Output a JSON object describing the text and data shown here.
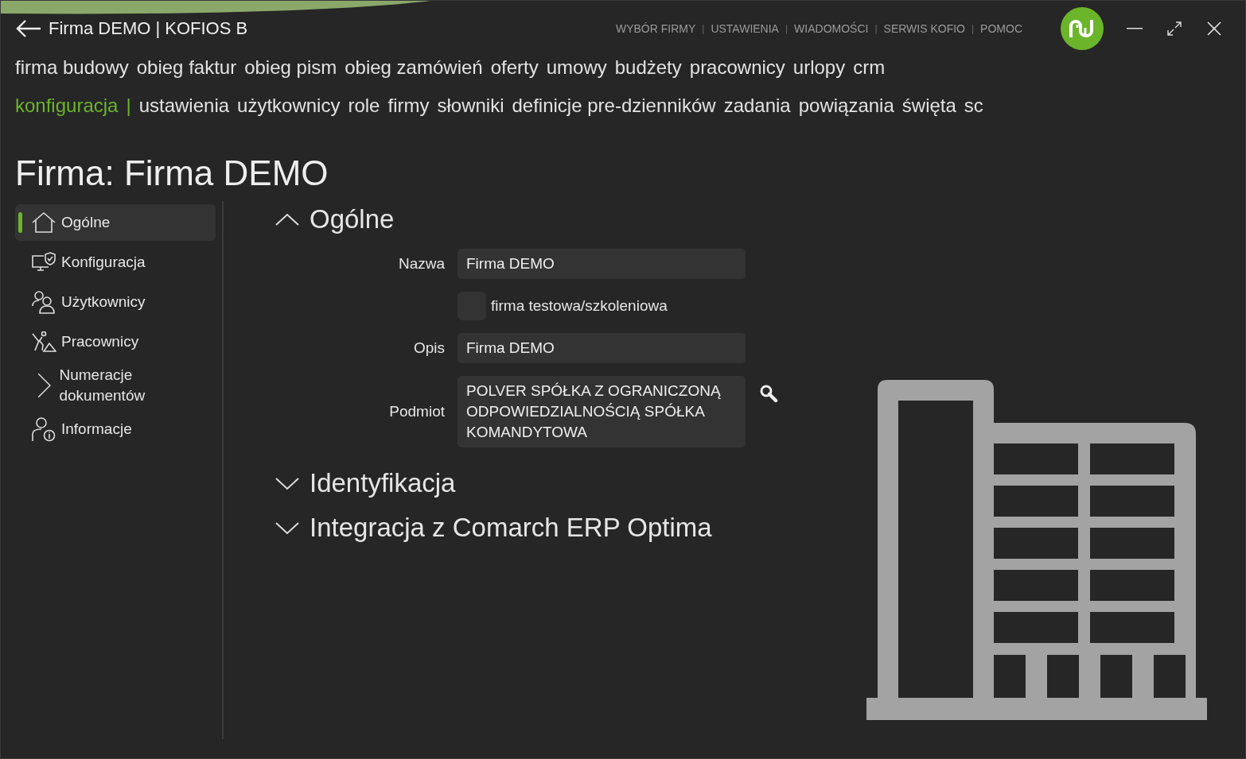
{
  "window": {
    "title": "Firma DEMO | KOFIOS B"
  },
  "top_links": [
    {
      "kind": "link",
      "text": "WYBÓR FIRMY"
    },
    {
      "kind": "separator",
      "text": "|"
    },
    {
      "kind": "link",
      "text": "USTAWIENIA"
    },
    {
      "kind": "separator",
      "text": "|"
    },
    {
      "kind": "link",
      "text": "WIADOMOŚCI"
    },
    {
      "kind": "separator",
      "text": "|"
    },
    {
      "kind": "link",
      "text": "SERWIS KOFIO"
    },
    {
      "kind": "separator",
      "text": "|"
    },
    {
      "kind": "link",
      "text": "POMOC"
    }
  ],
  "modules": [
    {
      "label": "firma budowy",
      "selected": false
    },
    {
      "label": "obieg faktur",
      "selected": false
    },
    {
      "label": "obieg pism",
      "selected": false
    },
    {
      "label": "obieg zamówień",
      "selected": false
    },
    {
      "label": "oferty",
      "selected": false
    },
    {
      "label": "umowy",
      "selected": false
    },
    {
      "label": "budżety",
      "selected": false
    },
    {
      "label": "pracownicy",
      "selected": false
    },
    {
      "label": "urlopy",
      "selected": false
    },
    {
      "label": "crm",
      "selected": false
    }
  ],
  "submenu": {
    "current": "konfiguracja",
    "separator": "|",
    "items": [
      {
        "label": "ustawienia",
        "selected": false
      },
      {
        "label": "użytkownicy",
        "selected": false
      },
      {
        "label": "role",
        "selected": false
      },
      {
        "label": "firmy",
        "selected": false
      },
      {
        "label": "słowniki",
        "selected": false
      },
      {
        "label": "definicje pre-dzienników",
        "selected": false
      },
      {
        "label": "zadania",
        "selected": false
      },
      {
        "label": "powiązania",
        "selected": false
      },
      {
        "label": "święta",
        "selected": false
      },
      {
        "label": "sc",
        "selected": false
      }
    ]
  },
  "page_title": "Firma: Firma DEMO",
  "sidebar": {
    "items": [
      {
        "label": "Ogólne",
        "kind": "home",
        "selected": true
      },
      {
        "label": "Konfiguracja",
        "kind": "monitor",
        "selected": false
      },
      {
        "label": "Użytkownicy",
        "kind": "users",
        "selected": false
      },
      {
        "label": "Pracownicy",
        "kind": "worker",
        "selected": false
      },
      {
        "label": "Numeracje dokumentów",
        "kind": "chevron",
        "selected": false
      },
      {
        "label": "Informacje",
        "kind": "info",
        "selected": false
      }
    ]
  },
  "sections": [
    {
      "title": "Ogólne",
      "expanded": true,
      "fields": [
        {
          "kind": "text",
          "label": "Nazwa",
          "value": "Firma DEMO"
        },
        {
          "kind": "checkbox",
          "label": "firma testowa/szkoleniowa",
          "checked": false
        },
        {
          "kind": "text",
          "label": "Opis",
          "value": "Firma DEMO"
        },
        {
          "kind": "lookup",
          "label": "Podmiot",
          "value": "POLVER SPÓŁKA Z OGRANICZONĄ ODPOWIEDZIALNOŚCIĄ SPÓŁKA KOMANDYTOWA"
        }
      ]
    },
    {
      "title": "Identyfikacja",
      "expanded": false
    },
    {
      "title": "Integracja z Comarch ERP Optima",
      "expanded": false
    }
  ]
}
